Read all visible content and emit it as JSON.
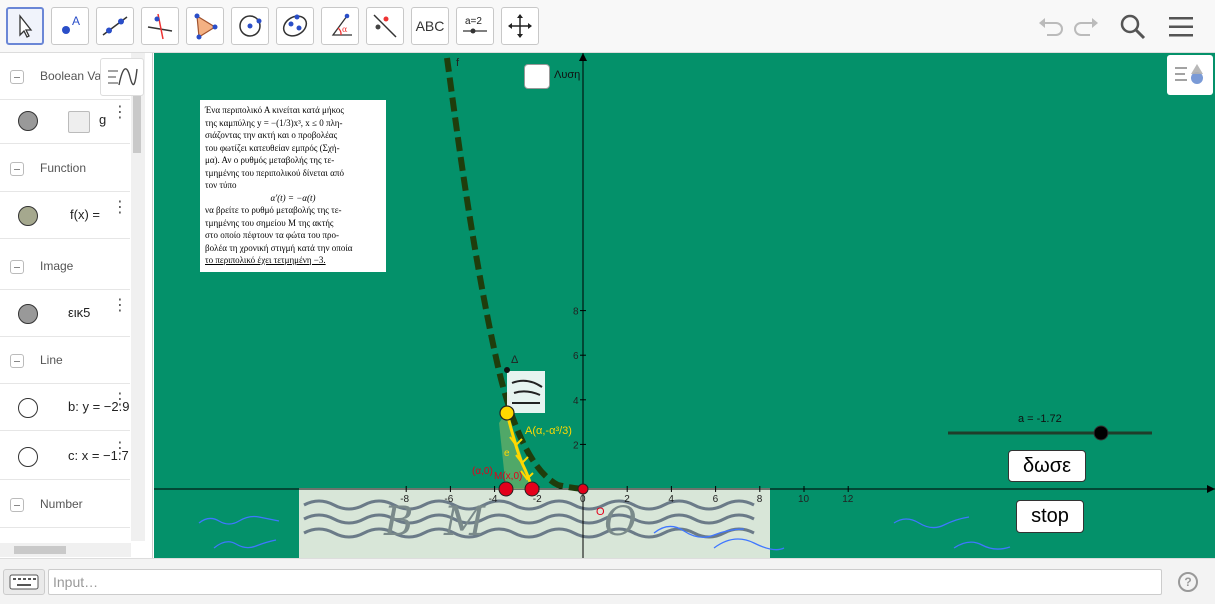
{
  "toolbar": {
    "tools": [
      "Move",
      "Point",
      "Line",
      "Perpendicular Line",
      "Polygon",
      "Circle",
      "Ellipse",
      "Angle",
      "Reflect",
      "ABC",
      "a=2",
      "Move Graphics View"
    ],
    "text_tool_label": "ABC",
    "slider_tool_label": "a=2"
  },
  "algebra": {
    "categories": [
      "Boolean Va",
      "Function",
      "Image",
      "Line",
      "Number"
    ],
    "rows": [
      {
        "name": "g",
        "def": "g"
      },
      {
        "name": "f",
        "def": "f(x) ="
      },
      {
        "name": "eik5",
        "def": "εικ5"
      },
      {
        "name": "b",
        "def": "b: y = −2.9"
      },
      {
        "name": "c",
        "def": "c: x = −1.7"
      }
    ]
  },
  "graphics": {
    "checkbox_label": "Λυση",
    "slider_label": "a = -1.72",
    "slider_value": -1.72,
    "button_dose": "δωσε",
    "button_stop": "stop",
    "curve_label": "f",
    "point_a_label": "A(α,-α³/3)",
    "point_m_label": "M(x,0)",
    "point_a2_label": "(α,0)",
    "delta_label": "Δ",
    "e_label": "e",
    "origin_label": "O",
    "x_ticks": [
      "-8",
      "-6",
      "-4",
      "-2",
      "0",
      "2",
      "4",
      "6",
      "8",
      "10",
      "12"
    ],
    "y_ticks": [
      "2",
      "4",
      "6",
      "8"
    ],
    "problem_lines": [
      "Ένα περιπολικό Α κινείται κατά μήκος",
      "της καμπύλης  y = −(1/3)x³,  x ≤ 0  πλη-",
      "σιάζοντας την ακτή και ο προβολέας",
      "του φωτίζει κατευθείαν εμπρός (Σχή-",
      "μα). Αν ο ρυθμός μεταβολής της τε-",
      "τμημένης του περιπολικού δίνεται από",
      "τον τύπο",
      "α′(t) = −α(t)",
      "να βρείτε το ρυθμό μεταβολής της τε-",
      "τμημένης του σημείου Μ της ακτής",
      "στο οποίο πέφτουν τα φώτα του προ-",
      "βολέα τη χρονική στιγμή κατά την οποία",
      "το περιπολικό έχει τετμημένη −3."
    ]
  },
  "inputbar": {
    "placeholder": "Input…",
    "help": "?"
  },
  "colors": {
    "background": "#04916a",
    "curve": "#1f3d0c",
    "point_a": "#ffd800",
    "point_red": "#e3001b",
    "axis": "#000000"
  }
}
